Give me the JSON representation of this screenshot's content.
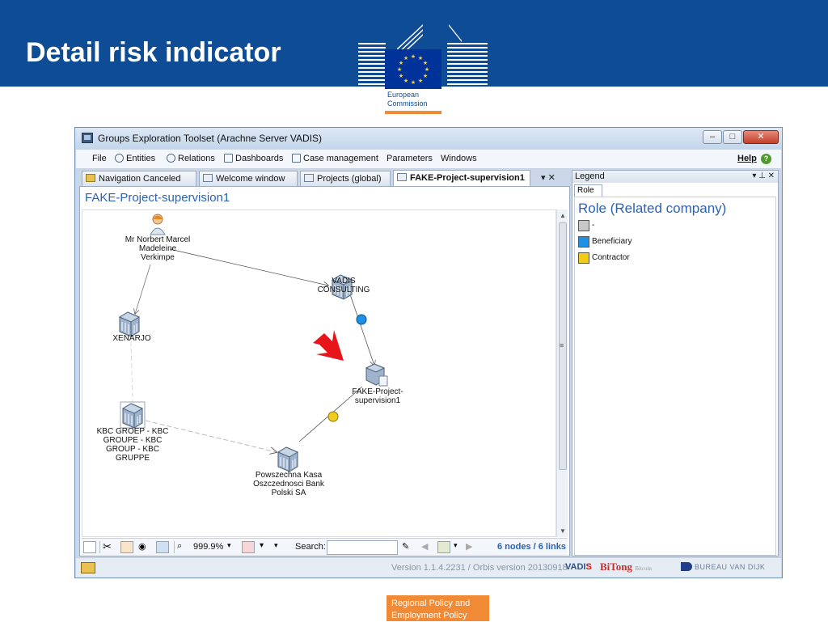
{
  "slide": {
    "title": "Detail risk indicator",
    "logo_line1": "European",
    "logo_line2": "Commission",
    "footer_line1": "Regional Policy and",
    "footer_line2": "Employment Policy"
  },
  "window": {
    "title": "Groups Exploration Toolset (Arachne Server VADIS)",
    "min_glyph": "–",
    "max_glyph": "□",
    "close_glyph": "✕"
  },
  "menu": {
    "items": [
      "File",
      "Entities",
      "Relations",
      "Dashboards",
      "Case management",
      "Parameters",
      "Windows"
    ],
    "help": "Help",
    "help_icon": "?"
  },
  "tabs": [
    {
      "label": "Navigation Canceled"
    },
    {
      "label": "Welcome window"
    },
    {
      "label": "Projects (global)"
    },
    {
      "label": "FAKE-Project-supervision1"
    }
  ],
  "tab_tools": "▾ ✕",
  "main": {
    "title": "FAKE-Project-supervision1"
  },
  "graph": {
    "nodes": [
      {
        "id": "person",
        "icon": "person-icon",
        "label": "Mr Norbert Marcel\nMadeleine\nVerkimpe"
      },
      {
        "id": "vadis",
        "icon": "building-icon",
        "label": "VADIS\nCONSULTING"
      },
      {
        "id": "xenarjo",
        "icon": "building-icon",
        "label": "XENARJO"
      },
      {
        "id": "fake",
        "icon": "project-icon",
        "label": "FAKE-Project-\nsupervision1"
      },
      {
        "id": "kbc",
        "icon": "building-icon",
        "label": "KBC GROEP - KBC\nGROUPE - KBC\nGROUP - KBC\nGRUPPE"
      },
      {
        "id": "pko",
        "icon": "building-icon",
        "label": "Powszechna Kasa\nOszczednosci Bank\nPolski SA"
      }
    ],
    "links": [
      {
        "from": "person",
        "to": "vadis",
        "role": ""
      },
      {
        "from": "person",
        "to": "xenarjo",
        "role": ""
      },
      {
        "from": "vadis",
        "to": "fake",
        "role": "Beneficiary"
      },
      {
        "from": "pko",
        "to": "fake",
        "role": "Contractor"
      },
      {
        "from": "kbc",
        "to": "pko",
        "role": ""
      },
      {
        "from": "xenarjo",
        "to": "kbc",
        "role": ""
      }
    ],
    "highlight": "red-arrow-icon"
  },
  "toolbar": {
    "zoom": "999.9%",
    "search_label": "Search:",
    "search_value": "",
    "summary": "6 nodes / 6 links"
  },
  "legend": {
    "header": "Legend",
    "tools": "▾ ⊥ ✕",
    "tab": "Role",
    "title": "Role (Related company)",
    "items": [
      {
        "label": "-",
        "color": "#c8c8c8"
      },
      {
        "label": "Beneficiary",
        "color": "#1e90e6"
      },
      {
        "label": "Contractor",
        "color": "#f2cc1a"
      }
    ]
  },
  "status": {
    "version": "Version 1.1.4.2231 / Orbis version 20130918",
    "vadis_a": "VADI",
    "vadis_b": "S",
    "bitong": "BiTong",
    "bitong_small": "Bitcoin",
    "bvd": "BUREAU VAN DIJK"
  },
  "colors": {
    "header_blue": "#0e4c96",
    "accent_orange": "#f08a34",
    "title_blue": "#2d62b2",
    "arrow_red": "#e8141b"
  }
}
